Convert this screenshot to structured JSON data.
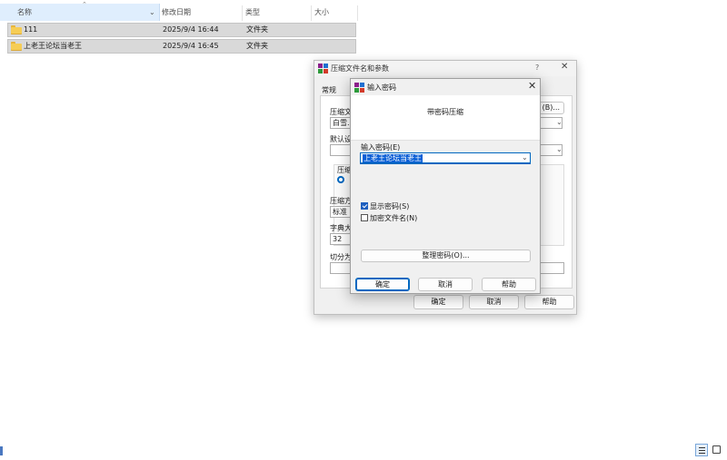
{
  "explorer": {
    "columns": {
      "name": "名称",
      "date": "修改日期",
      "type": "类型",
      "size": "大小"
    },
    "sort_indicator": "⌃",
    "rows": [
      {
        "name": "111",
        "date": "2025/9/4 16:44",
        "type": "文件夹"
      },
      {
        "name": "上老王论坛当老王",
        "date": "2025/9/4 16:45",
        "type": "文件夹"
      }
    ]
  },
  "archive_dialog": {
    "title": "压缩文件名和参数",
    "help_glyph": "?",
    "close_glyph": "✕",
    "tab": "常规",
    "archive_name_label": "压缩文",
    "archive_name_value": "白雪.r",
    "browse_button": "(B)...",
    "default_label": "默认设",
    "format_label": "压缩",
    "method_label": "压缩方",
    "method_value": "标准",
    "dict_label": "字典大",
    "dict_value": "32",
    "split_label": "切分为",
    "ok": "确定",
    "cancel": "取消",
    "help": "帮助"
  },
  "password_dialog": {
    "title": "输入密码",
    "close_glyph": "✕",
    "heading": "带密码压缩",
    "password_label": "输入密码(E)",
    "password_value": "上老王论坛当老王",
    "show_password": {
      "label": "显示密码(S)",
      "checked": true
    },
    "encrypt_names": {
      "label": "加密文件名(N)",
      "checked": false
    },
    "organize_button": "整理密码(O)...",
    "ok": "确定",
    "cancel": "取消",
    "help": "帮助"
  },
  "colors": {
    "accent": "#0067c0",
    "selection": "#0a5fd6",
    "folder": "#f6cd55"
  }
}
